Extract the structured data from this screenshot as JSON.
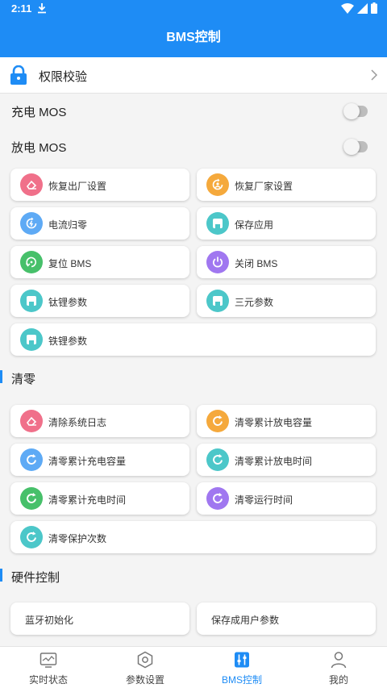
{
  "status_bar": {
    "time": "2:11"
  },
  "app_bar": {
    "title": "BMS控制"
  },
  "permission": {
    "label": "权限校验"
  },
  "charge_mos": {
    "label": "充电 MOS",
    "on": false
  },
  "discharge_mos": {
    "label": "放电 MOS",
    "on": false
  },
  "actions": [
    {
      "label": "恢复出厂设置",
      "icon": "eraser-icon",
      "color": "#f0708a"
    },
    {
      "label": "恢复厂家设置",
      "icon": "restore-person-icon",
      "color": "#f5a93c"
    },
    {
      "label": "电流归零",
      "icon": "current-reset-icon",
      "color": "#5eaaf5"
    },
    {
      "label": "保存应用",
      "icon": "save-icon",
      "color": "#4cc7c9"
    },
    {
      "label": "复位 BMS",
      "icon": "reset-icon",
      "color": "#47c06a"
    },
    {
      "label": "关闭 BMS",
      "icon": "power-icon",
      "color": "#a077f0"
    },
    {
      "label": "钛锂参数",
      "icon": "save-icon",
      "color": "#4cc7c9"
    },
    {
      "label": "三元参数",
      "icon": "save-icon",
      "color": "#4cc7c9"
    },
    {
      "label": "铁锂参数",
      "icon": "save-icon",
      "color": "#4cc7c9"
    }
  ],
  "clear_section": {
    "title": "清零"
  },
  "clear_actions": [
    {
      "label": "清除系统日志",
      "icon": "eraser-icon",
      "color": "#f0708a"
    },
    {
      "label": "清零累计放电容量",
      "icon": "refresh-icon",
      "color": "#f5a93c"
    },
    {
      "label": "清零累计充电容量",
      "icon": "refresh-icon",
      "color": "#5eaaf5"
    },
    {
      "label": "清零累计放电时间",
      "icon": "refresh-icon",
      "color": "#4cc7c9"
    },
    {
      "label": "清零累计充电时间",
      "icon": "refresh-icon",
      "color": "#47c06a"
    },
    {
      "label": "清零运行时间",
      "icon": "refresh-icon",
      "color": "#a077f0"
    },
    {
      "label": "清零保护次数",
      "icon": "refresh-icon",
      "color": "#4cc7c9"
    }
  ],
  "hardware_section": {
    "title": "硬件控制"
  },
  "hardware_actions": [
    {
      "label": "蓝牙初始化"
    },
    {
      "label": "保存成用户参数"
    }
  ],
  "bottom_nav": [
    {
      "label": "实时状态",
      "icon": "monitor-icon",
      "active": false
    },
    {
      "label": "参数设置",
      "icon": "hexagon-settings-icon",
      "active": false
    },
    {
      "label": "BMS控制",
      "icon": "control-sliders-icon",
      "active": true
    },
    {
      "label": "我的",
      "icon": "person-icon",
      "active": false
    }
  ],
  "colors": {
    "primary": "#1e8cf5",
    "background": "#f4f4f4"
  }
}
